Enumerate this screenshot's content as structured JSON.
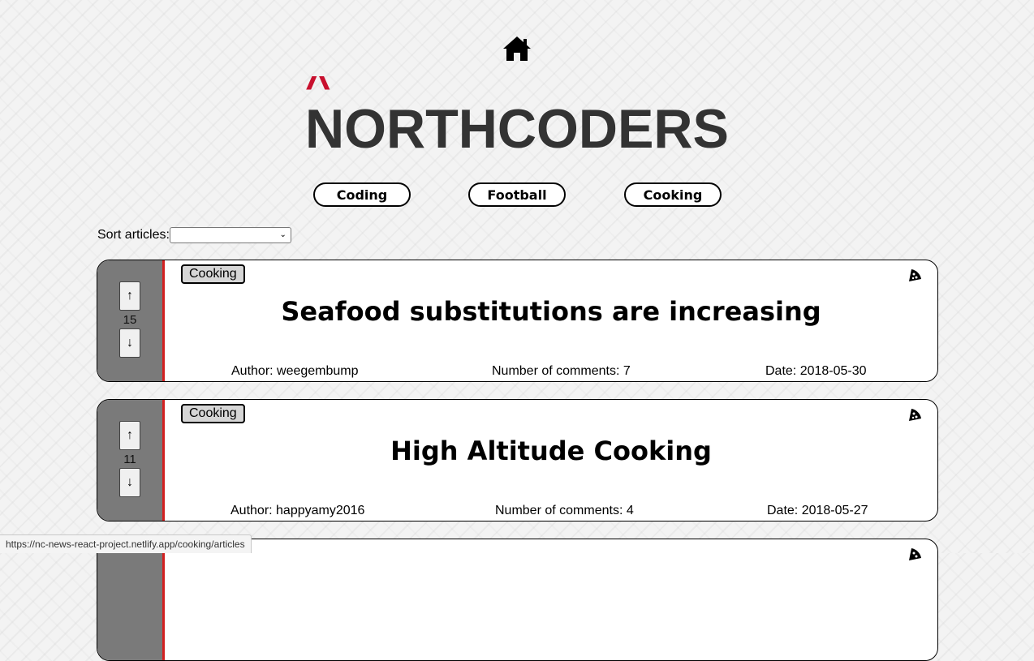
{
  "header": {
    "home_icon": "home-icon",
    "logo": {
      "caret": "^",
      "text": "NORTHCODERS"
    }
  },
  "topics": [
    {
      "label": "Coding"
    },
    {
      "label": "Football"
    },
    {
      "label": "Cooking"
    }
  ],
  "sort": {
    "label": "Sort articles:",
    "selected": ""
  },
  "articles": [
    {
      "topic": "Cooking",
      "votes": "15",
      "title": "Seafood substitutions are increasing",
      "author": "Author: weegembump",
      "comments": "Number of comments: 7",
      "date": "Date: 2018-05-30",
      "icon": "pizza-icon"
    },
    {
      "topic": "Cooking",
      "votes": "11",
      "title": "High Altitude Cooking",
      "author": "Author: happyamy2016",
      "comments": "Number of comments: 4",
      "date": "Date: 2018-05-27",
      "icon": "pizza-icon"
    }
  ],
  "vote": {
    "up": "↑",
    "down": "↓"
  },
  "status_bar": {
    "url": "https://nc-news-react-project.netlify.app/cooking/articles"
  },
  "colors": {
    "accent_red": "#c8102e",
    "logo_gray": "#333333",
    "vote_panel": "#7a7a7a",
    "card_border_red": "#d32020"
  }
}
